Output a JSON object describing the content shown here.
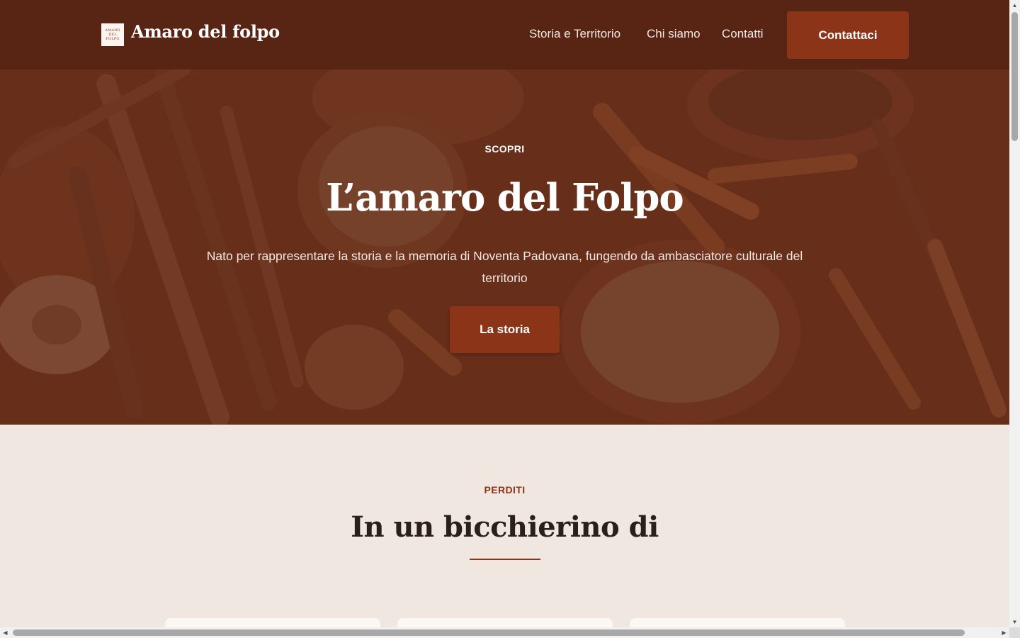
{
  "header": {
    "brand": "Amaro del folpo",
    "logo_lines": [
      "AMARO",
      "DEL",
      "FOLPO"
    ],
    "nav": [
      "Storia e Territorio",
      "Chi siamo",
      "Contatti"
    ],
    "cta": "Contattaci"
  },
  "hero": {
    "eyebrow": "SCOPRI",
    "title": "L’amaro del Folpo",
    "text": "Nato per rappresentare la storia e la memoria di Noventa Padovana, fungendo da ambasciatore culturale del territorio",
    "button": "La storia"
  },
  "section2": {
    "eyebrow": "PERDITI",
    "title": "In un bicchierino di"
  },
  "colors": {
    "header_bg": "#582414",
    "accent": "#8c3417",
    "page_bg": "#f0e7e0",
    "title_text": "#2a1f1a"
  },
  "icons": [
    "logo-icon",
    "scroll-up-icon",
    "scroll-down-icon",
    "scroll-left-icon",
    "scroll-right-icon"
  ]
}
